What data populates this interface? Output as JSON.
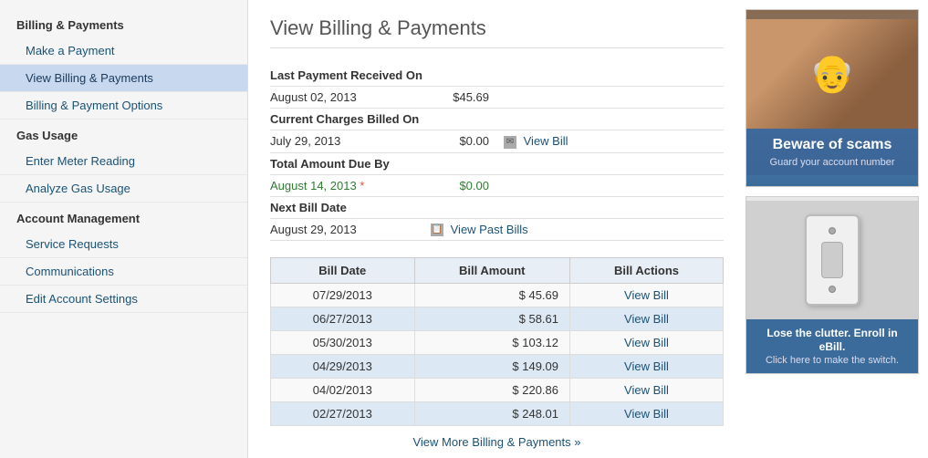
{
  "sidebar": {
    "sections": [
      {
        "header": "Billing & Payments",
        "items": [
          {
            "label": "Make a Payment",
            "active": false,
            "id": "make-payment"
          },
          {
            "label": "View Billing & Payments",
            "active": true,
            "id": "view-billing"
          },
          {
            "label": "Billing & Payment Options",
            "active": false,
            "id": "billing-options"
          }
        ]
      },
      {
        "header": "Gas Usage",
        "items": [
          {
            "label": "Enter Meter Reading",
            "active": false,
            "id": "meter-reading"
          },
          {
            "label": "Analyze Gas Usage",
            "active": false,
            "id": "analyze-gas"
          }
        ]
      },
      {
        "header": "Account Management",
        "items": [
          {
            "label": "Service Requests",
            "active": false,
            "id": "service-requests"
          },
          {
            "label": "Communications",
            "active": false,
            "id": "communications"
          },
          {
            "label": "Edit Account Settings",
            "active": false,
            "id": "edit-account"
          }
        ]
      }
    ]
  },
  "main": {
    "title": "View Billing & Payments",
    "billing_info": [
      {
        "label": "Last Payment Received On",
        "date": "August 02, 2013",
        "amount": "$45.69",
        "action": null,
        "date_green": false,
        "amount_green": false
      },
      {
        "label": "Current Charges Billed On",
        "date": "July 29, 2013",
        "amount": "$0.00",
        "action": "View Bill",
        "date_green": false,
        "amount_green": false
      },
      {
        "label": "Total Amount Due By",
        "date": "August 14, 2013 *",
        "amount": "$0.00",
        "action": null,
        "date_green": true,
        "amount_green": true
      },
      {
        "label": "Next Bill Date",
        "date": "August 29, 2013",
        "amount": null,
        "action": "View Past Bills",
        "date_green": false,
        "amount_green": false
      }
    ],
    "table": {
      "headers": [
        "Bill Date",
        "Bill Amount",
        "Bill Actions"
      ],
      "rows": [
        {
          "date": "07/29/2013",
          "amount": "$ 45.69",
          "action": "View Bill"
        },
        {
          "date": "06/27/2013",
          "amount": "$ 58.61",
          "action": "View Bill"
        },
        {
          "date": "05/30/2013",
          "amount": "$ 103.12",
          "action": "View Bill"
        },
        {
          "date": "04/29/2013",
          "amount": "$ 149.09",
          "action": "View Bill"
        },
        {
          "date": "04/02/2013",
          "amount": "$ 220.86",
          "action": "View Bill"
        },
        {
          "date": "02/27/2013",
          "amount": "$ 248.01",
          "action": "View Bill"
        }
      ]
    },
    "view_more_label": "View More Billing & Payments »"
  },
  "promos": [
    {
      "id": "scam-promo",
      "main_text": "Beware of scams",
      "sub_text": "Guard your account number"
    },
    {
      "id": "ebill-promo",
      "main_text": "Lose the clutter. Enroll in eBill.",
      "sub_text": "Click here to make the switch."
    }
  ]
}
